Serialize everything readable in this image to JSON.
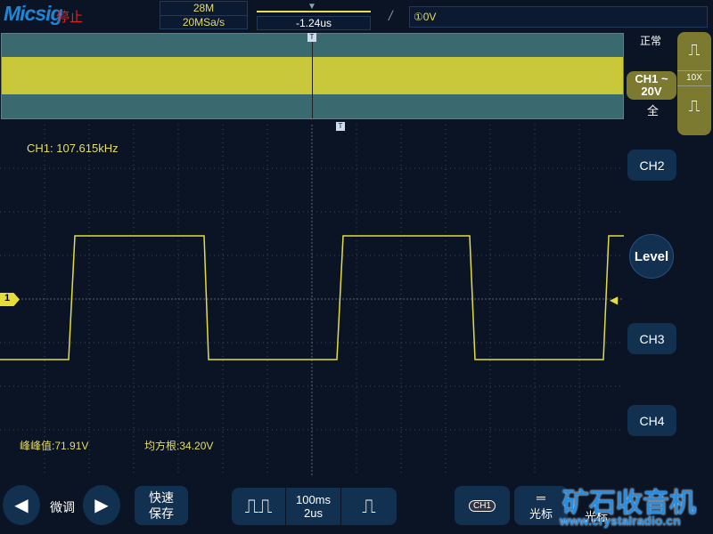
{
  "header": {
    "logo": "Micsig",
    "run_state": "停止",
    "memory_depth": "28M",
    "sample_rate": "20MSa/s",
    "trigger_offset": "-1.24us",
    "trigger_edge": "/",
    "trigger_level": "①0V"
  },
  "right_panel": {
    "mode": "正常",
    "channel": "CH1",
    "coupling_icon": "~",
    "scale": "20V",
    "bandwidth": "全",
    "probe": "10X",
    "ch2": "CH2",
    "level": "Level",
    "ch3": "CH3",
    "ch4": "CH4"
  },
  "measurements": {
    "frequency": "CH1: 107.615kHz",
    "vpp": "峰峰值:71.91V",
    "vrms": "均方根:34.20V"
  },
  "channel_marker": "1",
  "footer": {
    "fine_tune": "微调",
    "quick_save_1": "快速",
    "quick_save_2": "保存",
    "timebase_1": "100ms",
    "timebase_2": "2us",
    "ch_stack": "CH1",
    "cursor": "光标",
    "cursor2": "光标",
    "watermark": "矿石收音机",
    "watermark_url": "www.crystalradio.cn"
  },
  "colors": {
    "trace": "#e6dc3c",
    "bg": "#0a1425",
    "accent": "#1e86d6"
  }
}
